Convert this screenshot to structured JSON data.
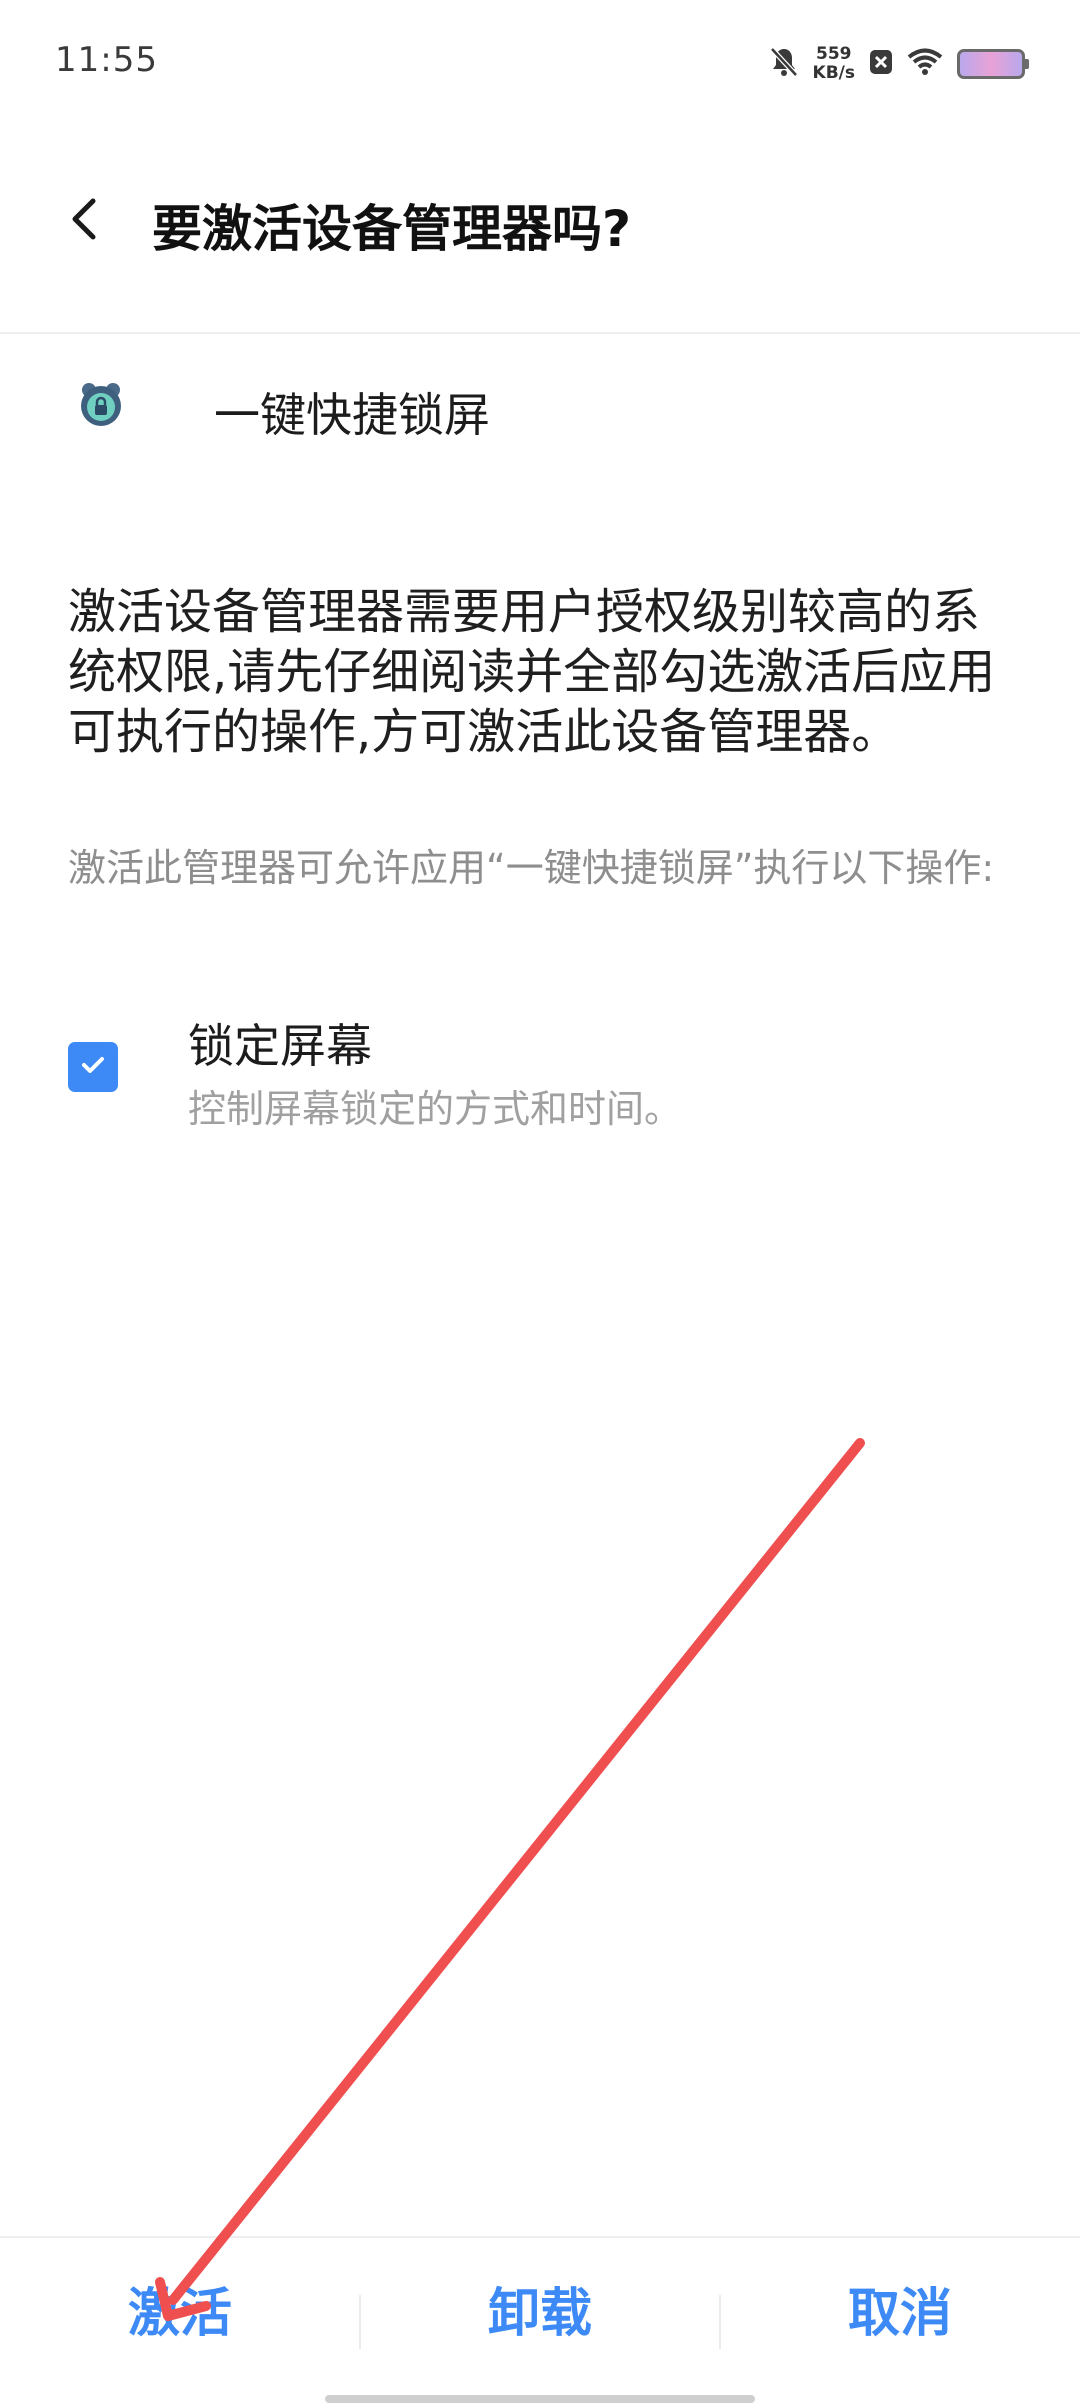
{
  "status_bar": {
    "time": "11:55",
    "net_speed_value": "559",
    "net_speed_unit": "KB/s",
    "icons": [
      "bell-off-icon",
      "close-box-icon",
      "wifi-icon",
      "battery-icon"
    ]
  },
  "header": {
    "title": "要激活设备管理器吗?",
    "back_icon": "back-arrow-icon"
  },
  "app": {
    "name": "一键快捷锁屏",
    "icon": "lock-app-icon"
  },
  "description": "激活设备管理器需要用户授权级别较高的系统权限,请先仔细阅读并全部勾选激活后应用可执行的操作,方可激活此设备管理器。",
  "allow_text": "激活此管理器可允许应用“一键快捷锁屏”执行以下操作:",
  "permissions": [
    {
      "title": "锁定屏幕",
      "description": "控制屏幕锁定的方式和时间。",
      "checked": true
    }
  ],
  "bottom_bar": {
    "activate_label": "激活",
    "uninstall_label": "卸载",
    "cancel_label": "取消"
  },
  "colors": {
    "accent": "#3d8af7",
    "annotation_arrow": "#ef4f4f"
  }
}
